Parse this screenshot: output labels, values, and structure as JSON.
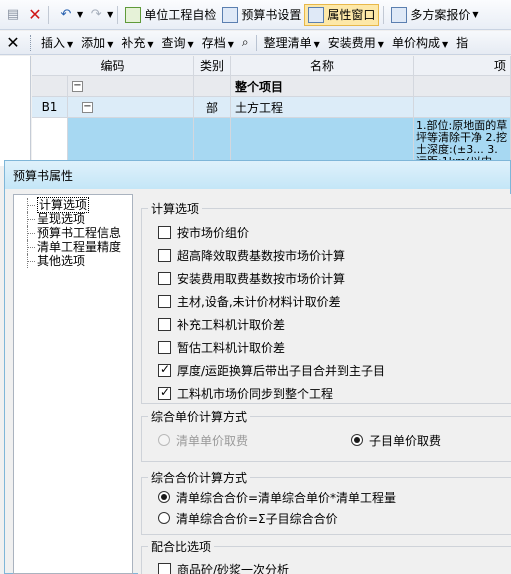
{
  "toolbar1": {
    "unit_check": "单位工程自检",
    "budget_settings": "预算书设置",
    "property_window": "属性窗口",
    "multi_quote": "多方案报价"
  },
  "toolbar2": {
    "insert": "插入",
    "add": "添加",
    "supplement": "补充",
    "query": "查询",
    "archive": "存档",
    "organize_list": "整理清单",
    "install_fee": "安装费用",
    "unit_price_comp": "单价构成",
    "more": "指"
  },
  "grid": {
    "headers": {
      "code": "编码",
      "type": "类别",
      "name": "名称",
      "feature": "项"
    },
    "rows": [
      {
        "code": "",
        "type": "",
        "name": "整个项目",
        "feature": ""
      },
      {
        "code": "B1",
        "type": "部",
        "name": "土方工程",
        "feature": ""
      },
      {
        "code": "",
        "type": "",
        "name": "",
        "feature": "1.部位:原地面的草坪等清除干净 2.挖土深度:(±3... 3.运距:1km(以内..."
      }
    ]
  },
  "dialog": {
    "title": "预算书属性",
    "nav": [
      "计算选项",
      "呈现选项",
      "预算书工程信息",
      "清单工程量精度",
      "其他选项"
    ],
    "calc_group": {
      "title": "计算选项",
      "options": [
        {
          "label": "按市场价组价",
          "checked": false
        },
        {
          "label": "超高降效取费基数按市场价计算",
          "checked": false
        },
        {
          "label": "安装费用取费基数按市场价计算",
          "checked": false
        },
        {
          "label": "主材,设备,未计价材料计取价差",
          "checked": false
        },
        {
          "label": "补充工料机计取价差",
          "checked": false
        },
        {
          "label": "暂估工料机计取价差",
          "checked": false
        },
        {
          "label": "厚度/运距换算后带出子目合并到主子目",
          "checked": true
        },
        {
          "label": "工料机市场价同步到整个工程",
          "checked": true
        }
      ]
    },
    "unit_price_group": {
      "title": "综合单价计算方式",
      "options": [
        {
          "label": "清单单价取费",
          "selected": false,
          "disabled": true
        },
        {
          "label": "子目单价取费",
          "selected": true,
          "disabled": false
        }
      ]
    },
    "total_price_group": {
      "title": "综合合价计算方式",
      "options": [
        {
          "label": "清单综合合价=清单综合单价*清单工程量",
          "selected": true
        },
        {
          "label": "清单综合合价=Σ子目综合合价",
          "selected": false
        }
      ]
    },
    "mix_group": {
      "title": "配合比选项",
      "options": [
        {
          "label": "商品砼/砂浆一次分析",
          "checked": false
        }
      ]
    }
  }
}
